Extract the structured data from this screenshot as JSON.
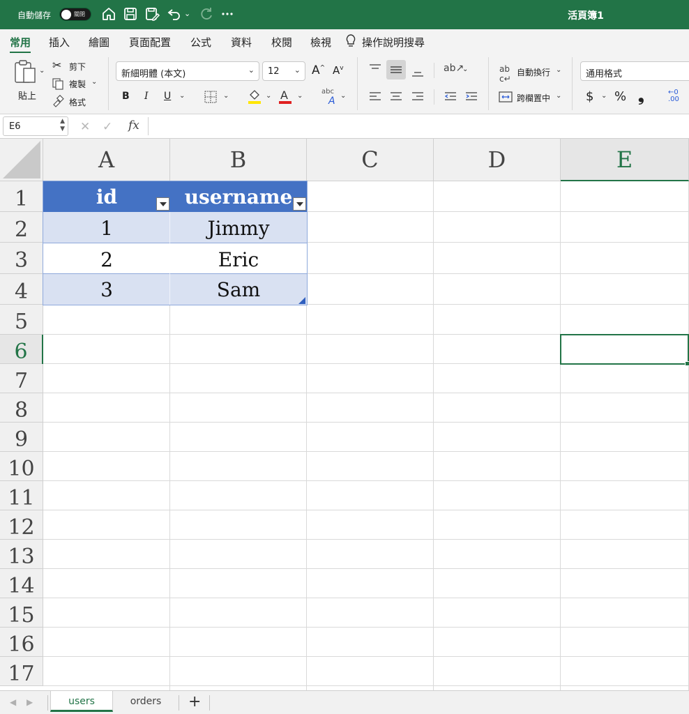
{
  "titlebar": {
    "autosave_label": "自動儲存",
    "autosave_state": "關閉",
    "doc_title": "活頁簿1",
    "icons": [
      "home-icon",
      "save-icon",
      "save-as-icon",
      "undo-icon",
      "redo-icon",
      "more-icon"
    ]
  },
  "menu": {
    "tabs": [
      "常用",
      "插入",
      "繪圖",
      "頁面配置",
      "公式",
      "資料",
      "校閱",
      "檢視"
    ],
    "active": "常用",
    "tell_me": "操作說明搜尋"
  },
  "ribbon": {
    "paste": "貼上",
    "cut": "剪下",
    "copy": "複製",
    "format_painter": "格式",
    "font_name": "新細明體 (本文)",
    "font_size": "12",
    "bold": "B",
    "italic": "I",
    "underline": "U",
    "wrap_text": "自動換行",
    "merge_center": "跨欄置中",
    "number_format": "通用格式",
    "currency": "$",
    "percent": "%",
    "comma": "❟",
    "colors": {
      "highlight": "#ffe600",
      "font_color": "#e02020"
    }
  },
  "formula_bar": {
    "name_box": "E6",
    "cancel": "✕",
    "enter": "✓",
    "fx": "fx",
    "content": ""
  },
  "sheet": {
    "columns": [
      "A",
      "B",
      "C",
      "D",
      "E"
    ],
    "selected_column": "E",
    "rows": [
      "1",
      "2",
      "3",
      "4",
      "5",
      "6",
      "7",
      "8",
      "9",
      "10",
      "11",
      "12",
      "13",
      "14",
      "15",
      "16",
      "17"
    ],
    "selected_row": "6",
    "active_cell": "E6",
    "table": {
      "headers": [
        "id",
        "username"
      ],
      "rows": [
        [
          "1",
          "Jimmy"
        ],
        [
          "2",
          "Eric"
        ],
        [
          "3",
          "Sam"
        ]
      ],
      "header_color": "#4472c4",
      "band_color": "#d9e1f2"
    }
  },
  "sheet_tabs": {
    "tabs": [
      "users",
      "orders"
    ],
    "active": "users",
    "add_label": "+"
  }
}
